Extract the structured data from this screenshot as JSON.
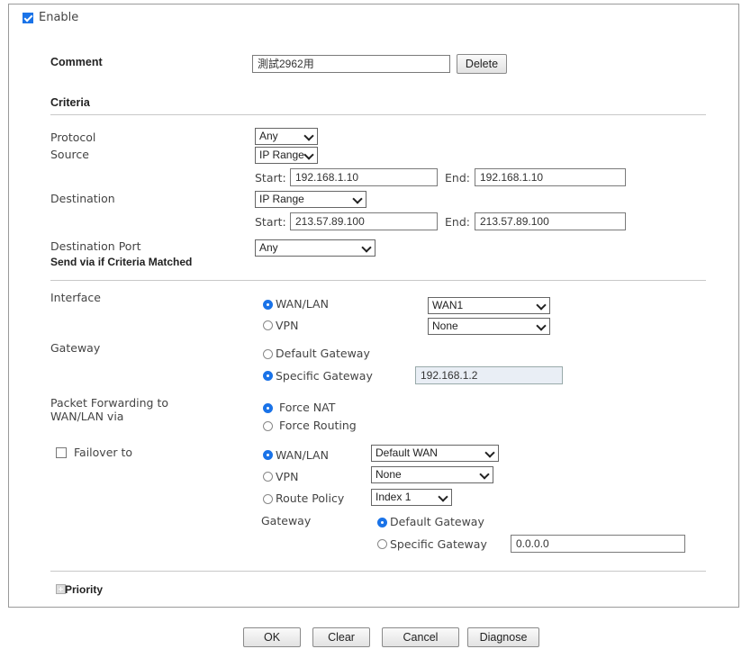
{
  "enable_label": "Enable",
  "comment": {
    "label": "Comment",
    "value": "測試2962用",
    "delete_label": "Delete"
  },
  "criteria": {
    "title": "Criteria",
    "protocol_label": "Protocol",
    "protocol_value": "Any",
    "source_label": "Source",
    "source_type": "IP Range",
    "source_start_label": "Start:",
    "source_start": "192.168.1.10",
    "source_end_label": "End:",
    "source_end": "192.168.1.10",
    "destination_label": "Destination",
    "destination_type": "IP Range",
    "destination_start_label": "Start:",
    "destination_start": "213.57.89.100",
    "destination_end_label": "End:",
    "destination_end": "213.57.89.100",
    "dest_port_label": "Destination Port",
    "dest_port_value": "Any"
  },
  "send_via": {
    "title": "Send via if Criteria Matched",
    "interface_label": "Interface",
    "wan_lan_label": "WAN/LAN",
    "wan_lan_select": "WAN1",
    "vpn_label": "VPN",
    "vpn_select": "None",
    "gateway_label": "Gateway",
    "default_gateway_label": "Default Gateway",
    "specific_gateway_label": "Specific Gateway",
    "specific_gateway_value": "192.168.1.2",
    "packet_forwarding_label_1": "Packet Forwarding to",
    "packet_forwarding_label_2": "WAN/LAN via",
    "force_nat_label": "Force NAT",
    "force_routing_label": "Force Routing",
    "failover_label": "Failover to",
    "failover_wan_lan_label": "WAN/LAN",
    "failover_wan_lan_select": "Default WAN",
    "failover_vpn_label": "VPN",
    "failover_vpn_select": "None",
    "failover_route_policy_label": "Route Policy",
    "failover_route_policy_select": "Index 1",
    "failover_gateway_label": "Gateway",
    "failover_default_gateway_label": "Default Gateway",
    "failover_specific_gateway_label": "Specific Gateway",
    "failover_specific_gateway_value": "0.0.0.0"
  },
  "priority_label": "Priority",
  "buttons": {
    "ok": "OK",
    "clear": "Clear",
    "cancel": "Cancel",
    "diagnose": "Diagnose"
  },
  "colors": {
    "accent": "#1a73e8",
    "border": "#9a9a9a"
  }
}
